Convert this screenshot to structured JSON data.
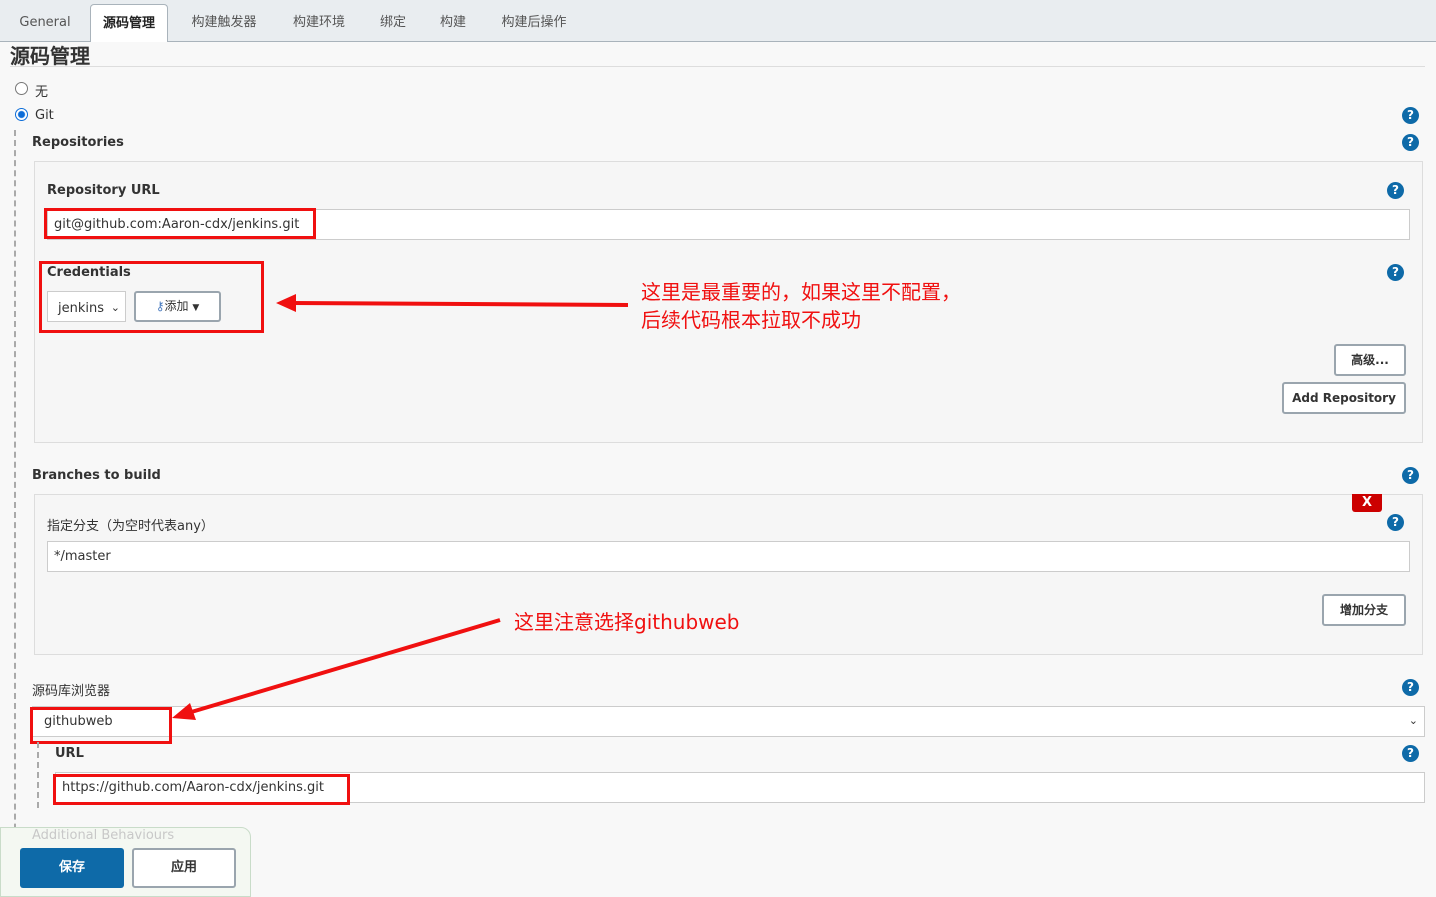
{
  "tabs": [
    "General",
    "源码管理",
    "构建触发器",
    "构建环境",
    "绑定",
    "构建",
    "构建后操作"
  ],
  "active_tab": "源码管理",
  "section_title": "源码管理",
  "scm_options": [
    {
      "label": "无",
      "selected": false
    },
    {
      "label": "Git",
      "selected": true
    }
  ],
  "repositories_label": "Repositories",
  "repo_url_label": "Repository URL",
  "repo_url_value": "git@github.com:Aaron-cdx/jenkins.git",
  "credentials_label": "Credentials",
  "credentials_value": "jenkins",
  "add_button": "添加",
  "advanced_button": "高级...",
  "add_repository_button": "Add Repository",
  "branches_label": "Branches to build",
  "branch_spec_label": "指定分支（为空时代表any）",
  "branch_spec_value": "*/master",
  "delete_label": "X",
  "add_branch_button": "增加分支",
  "browser_label": "源码库浏览器",
  "browser_value": "githubweb",
  "url_label": "URL",
  "url_value": "https://github.com/Aaron-cdx/jenkins.git",
  "additional_behaviours": "Additional Behaviours",
  "save_button": "保存",
  "apply_button": "应用",
  "annotations": [
    "这里是最重要的，如果这里不配置，",
    "后续代码根本拉取不成功",
    "这里注意选择githubweb"
  ],
  "colors": {
    "accent": "#0e6aa8",
    "annotation": "#f01010",
    "delete": "#cc0000"
  }
}
